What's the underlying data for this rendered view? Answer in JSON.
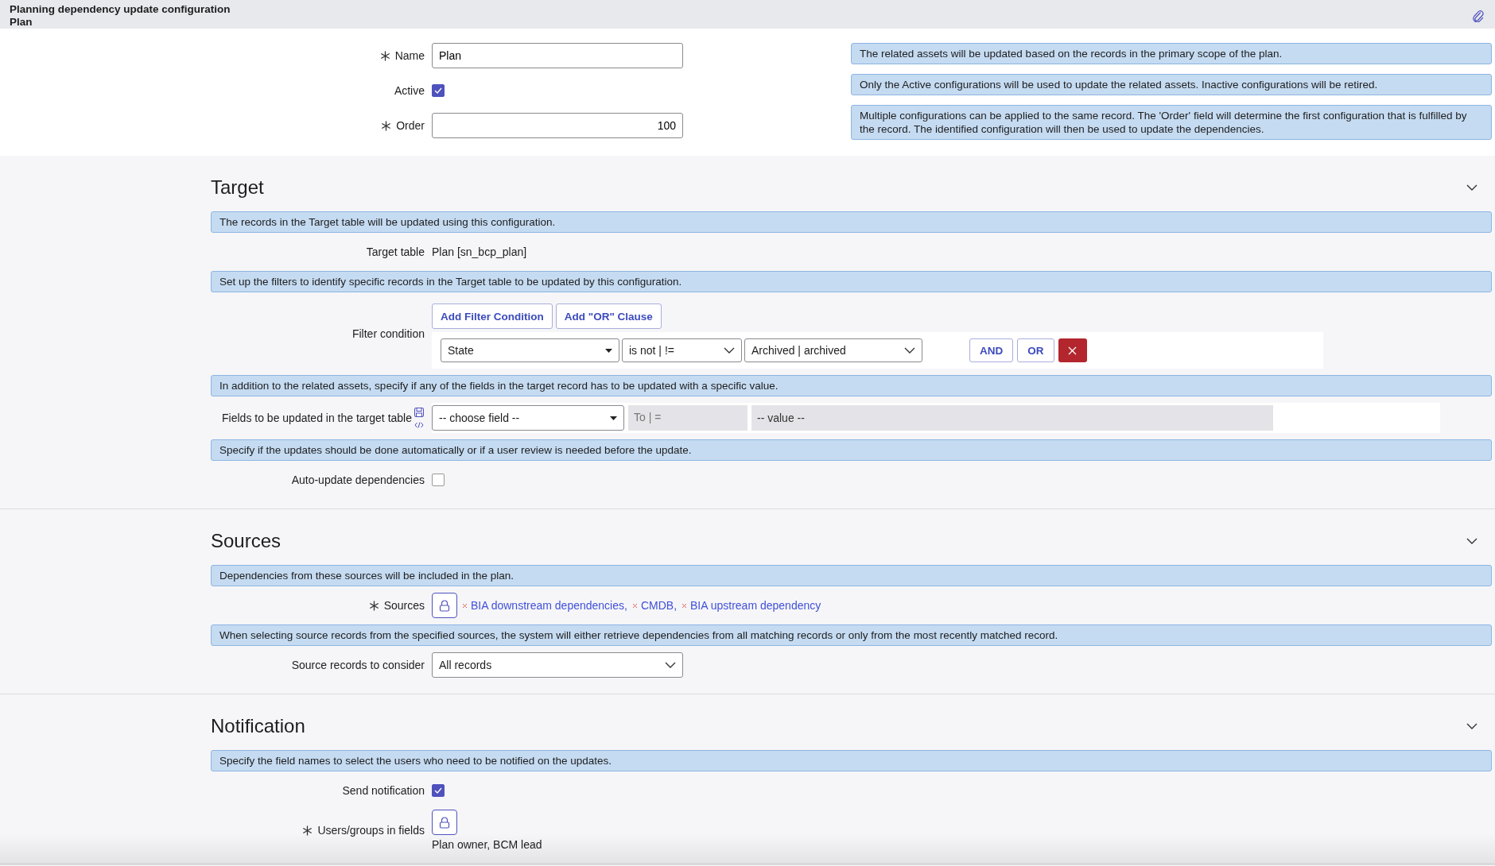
{
  "header": {
    "title": "Planning dependency update configuration",
    "subtitle": "Plan"
  },
  "top": {
    "fields": [
      {
        "kind": "text",
        "label": "Name",
        "required": true,
        "value": "Plan"
      },
      {
        "kind": "checkbox",
        "label": "Active",
        "required": false,
        "checked": true
      },
      {
        "kind": "number",
        "label": "Order",
        "required": true,
        "value": "100"
      }
    ],
    "notes": [
      "The related assets will be updated based on the records in the primary scope of the plan.",
      "Only the Active configurations will be used to update the related assets. Inactive configurations will be retired.",
      "Multiple configurations can be applied to the same record. The 'Order' field will determine the first configuration that is fulfilled by the record. The identified configuration will then be used to update the dependencies."
    ]
  },
  "sections": [
    {
      "title": "Target",
      "expanded": true,
      "rows": [
        {
          "kind": "info",
          "text": "The records in the Target table will be updated using this configuration."
        },
        {
          "kind": "readonly",
          "label": "Target table",
          "required": false,
          "value": "Plan [sn_bcp_plan]"
        },
        {
          "kind": "info",
          "text": "Set up the filters to identify specific records in the Target table to be updated by this configuration."
        },
        {
          "kind": "filter",
          "label": "Filter condition",
          "required": false,
          "buttons": [
            "Add Filter Condition",
            "Add \"OR\" Clause"
          ],
          "field": "State",
          "operator": "is not | !=",
          "value": "Archived | archived",
          "actions": [
            "AND",
            "OR"
          ]
        },
        {
          "kind": "info",
          "text": "In addition to the related assets, specify if any of the fields in the target record has to be updated with a specific value."
        },
        {
          "kind": "setfield",
          "label": "Fields to be updated in the target table",
          "required": false,
          "field": "-- choose field --",
          "operator": "To | =",
          "placeholder": "-- value --"
        },
        {
          "kind": "info",
          "text": "Specify if the updates should be done automatically or if a user review is needed before the update."
        },
        {
          "kind": "checkbox",
          "label": "Auto-update dependencies",
          "required": false,
          "checked": false
        }
      ]
    },
    {
      "title": "Sources",
      "expanded": true,
      "rows": [
        {
          "kind": "info",
          "text": "Dependencies from these sources will be included in the plan."
        },
        {
          "kind": "list",
          "label": "Sources",
          "required": true,
          "items": [
            {
              "label": "BIA downstream dependencies",
              "separator": ","
            },
            {
              "label": "CMDB",
              "separator": ","
            },
            {
              "label": "BIA upstream dependency"
            }
          ]
        },
        {
          "kind": "info",
          "text": "When selecting source records from the specified sources, the system will either retrieve dependencies from all matching records or only from the most recently matched record."
        },
        {
          "kind": "select",
          "label": "Source records to consider",
          "required": false,
          "value": "All records"
        }
      ]
    },
    {
      "title": "Notification",
      "expanded": true,
      "rows": [
        {
          "kind": "info",
          "text": "Specify the field names to select the users who need to be notified on the updates."
        },
        {
          "kind": "checkbox",
          "label": "Send notification",
          "required": false,
          "checked": true
        },
        {
          "kind": "list",
          "label": "Users/groups in fields",
          "required": true,
          "text": "Plan owner, BCM lead"
        }
      ]
    }
  ]
}
